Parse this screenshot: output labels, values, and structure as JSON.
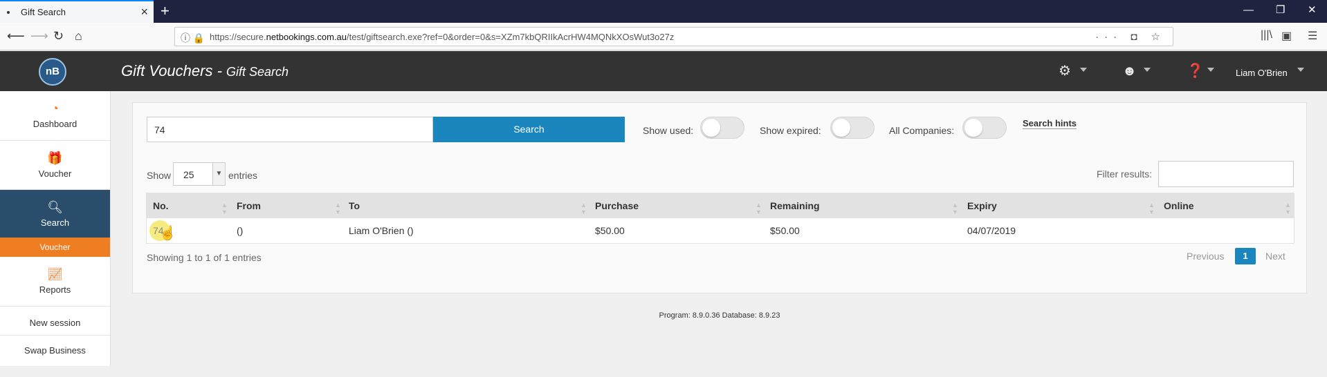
{
  "browser": {
    "tab_title": "Gift Search",
    "url_host_prefix": "https://secure.",
    "url_host": "netbookings.com.au",
    "url_path": "/test/giftsearch.exe?ref=0&order=0&s=XZm7kbQRIIkAcrHW4MQNkXOsWut3o27z",
    "icons": [
      "back-icon",
      "forward-icon",
      "reload-icon",
      "home-icon",
      "info-icon",
      "lock-icon",
      "more-icon",
      "pocket-icon",
      "bookmark-star-icon",
      "library-icon",
      "sidebar-icon",
      "menu-icon"
    ]
  },
  "header": {
    "logo_text": "nB",
    "title_main": "Gift Vouchers",
    "title_sep": " - ",
    "title_sub": "Gift Search",
    "user_name": "Liam O'Brien"
  },
  "sidebar": {
    "items": [
      {
        "label": "Dashboard",
        "icon": "dashboard-icon"
      },
      {
        "label": "Voucher",
        "icon": "gift-icon"
      },
      {
        "label": "Search",
        "icon": "search-icon"
      },
      {
        "label": "Reports",
        "icon": "chart-icon"
      }
    ],
    "active_sub": "Voucher",
    "new_session": "New session",
    "swap_business": "Swap Business"
  },
  "search": {
    "value": "74",
    "button": "Search",
    "show_used": "Show used:",
    "show_expired": "Show expired:",
    "all_companies": "All Companies:",
    "hints": "Search hints"
  },
  "table_controls": {
    "show": "Show",
    "entries_value": "25",
    "entries": "entries",
    "filter_label": "Filter results:",
    "filter_value": ""
  },
  "table": {
    "columns": [
      "No.",
      "From",
      "To",
      "Purchase",
      "Remaining",
      "Expiry",
      "Online"
    ],
    "rows": [
      {
        "no": "74",
        "from": "()",
        "to": "Liam O'Brien ()",
        "purchase": "$50.00",
        "remaining": "$50.00",
        "expiry": "04/07/2019",
        "online": ""
      }
    ]
  },
  "pagination": {
    "summary": "Showing 1 to 1 of 1 entries",
    "previous": "Previous",
    "current": "1",
    "next": "Next"
  },
  "footer": {
    "text": "Program: 8.9.0.36 Database: 8.9.23"
  },
  "colors": {
    "accent_blue": "#1a86bd",
    "orange": "#ef7d22",
    "sidebar_active": "#2a4d6c",
    "header_bg": "#333333"
  }
}
